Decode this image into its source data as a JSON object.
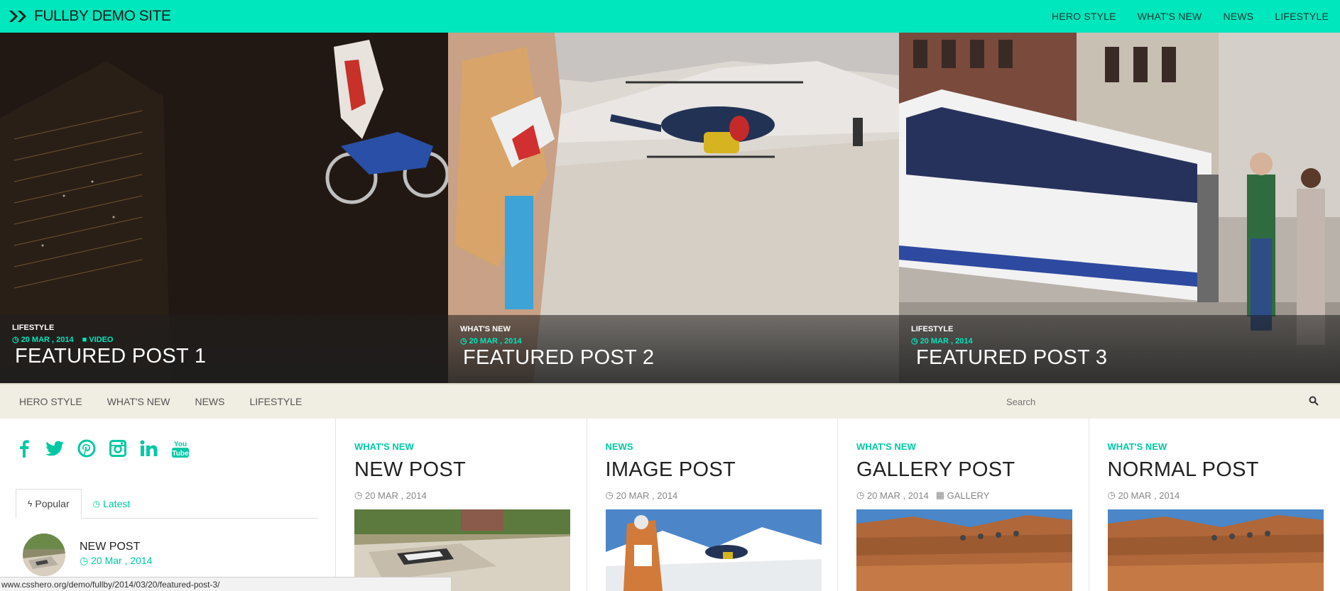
{
  "site": {
    "title": "FULLBY DEMO SITE"
  },
  "topnav": [
    "HERO STYLE",
    "WHAT'S NEW",
    "NEWS",
    "LIFESTYLE"
  ],
  "featured": [
    {
      "category": "LIFESTYLE",
      "date": "20 MAR , 2014",
      "format": "VIDEO",
      "title": "FEATURED POST 1"
    },
    {
      "category": "WHAT'S NEW",
      "date": "20 MAR , 2014",
      "title": "FEATURED POST 2"
    },
    {
      "category": "LIFESTYLE",
      "date": "20 MAR , 2014",
      "title": "FEATURED POST 3"
    }
  ],
  "subnav": [
    "HERO STYLE",
    "WHAT'S NEW",
    "NEWS",
    "LIFESTYLE"
  ],
  "search": {
    "placeholder": "Search"
  },
  "social": [
    "facebook-icon",
    "twitter-icon",
    "pinterest-icon",
    "instagram-icon",
    "linkedin-icon",
    "youtube-icon"
  ],
  "sidebar": {
    "tabs": [
      "Popular",
      "Latest"
    ],
    "popular": [
      {
        "title": "NEW POST",
        "date": "20 Mar , 2014"
      }
    ]
  },
  "posts": [
    {
      "category": "WHAT'S NEW",
      "title": "NEW POST",
      "date": "20 MAR , 2014"
    },
    {
      "category": "NEWS",
      "title": "IMAGE POST",
      "date": "20 MAR , 2014"
    },
    {
      "category": "WHAT'S NEW",
      "title": "GALLERY POST",
      "date": "20 MAR , 2014",
      "format": "GALLERY"
    },
    {
      "category": "WHAT'S NEW",
      "title": "NORMAL POST",
      "date": "20 MAR , 2014"
    }
  ],
  "statusbar": {
    "url": "www.csshero.org/demo/fullby/2014/03/20/featured-post-3/"
  },
  "colors": {
    "accent": "#00e6bd",
    "accent_text": "#00c9a4",
    "subnav_bg": "#f0ede2"
  }
}
